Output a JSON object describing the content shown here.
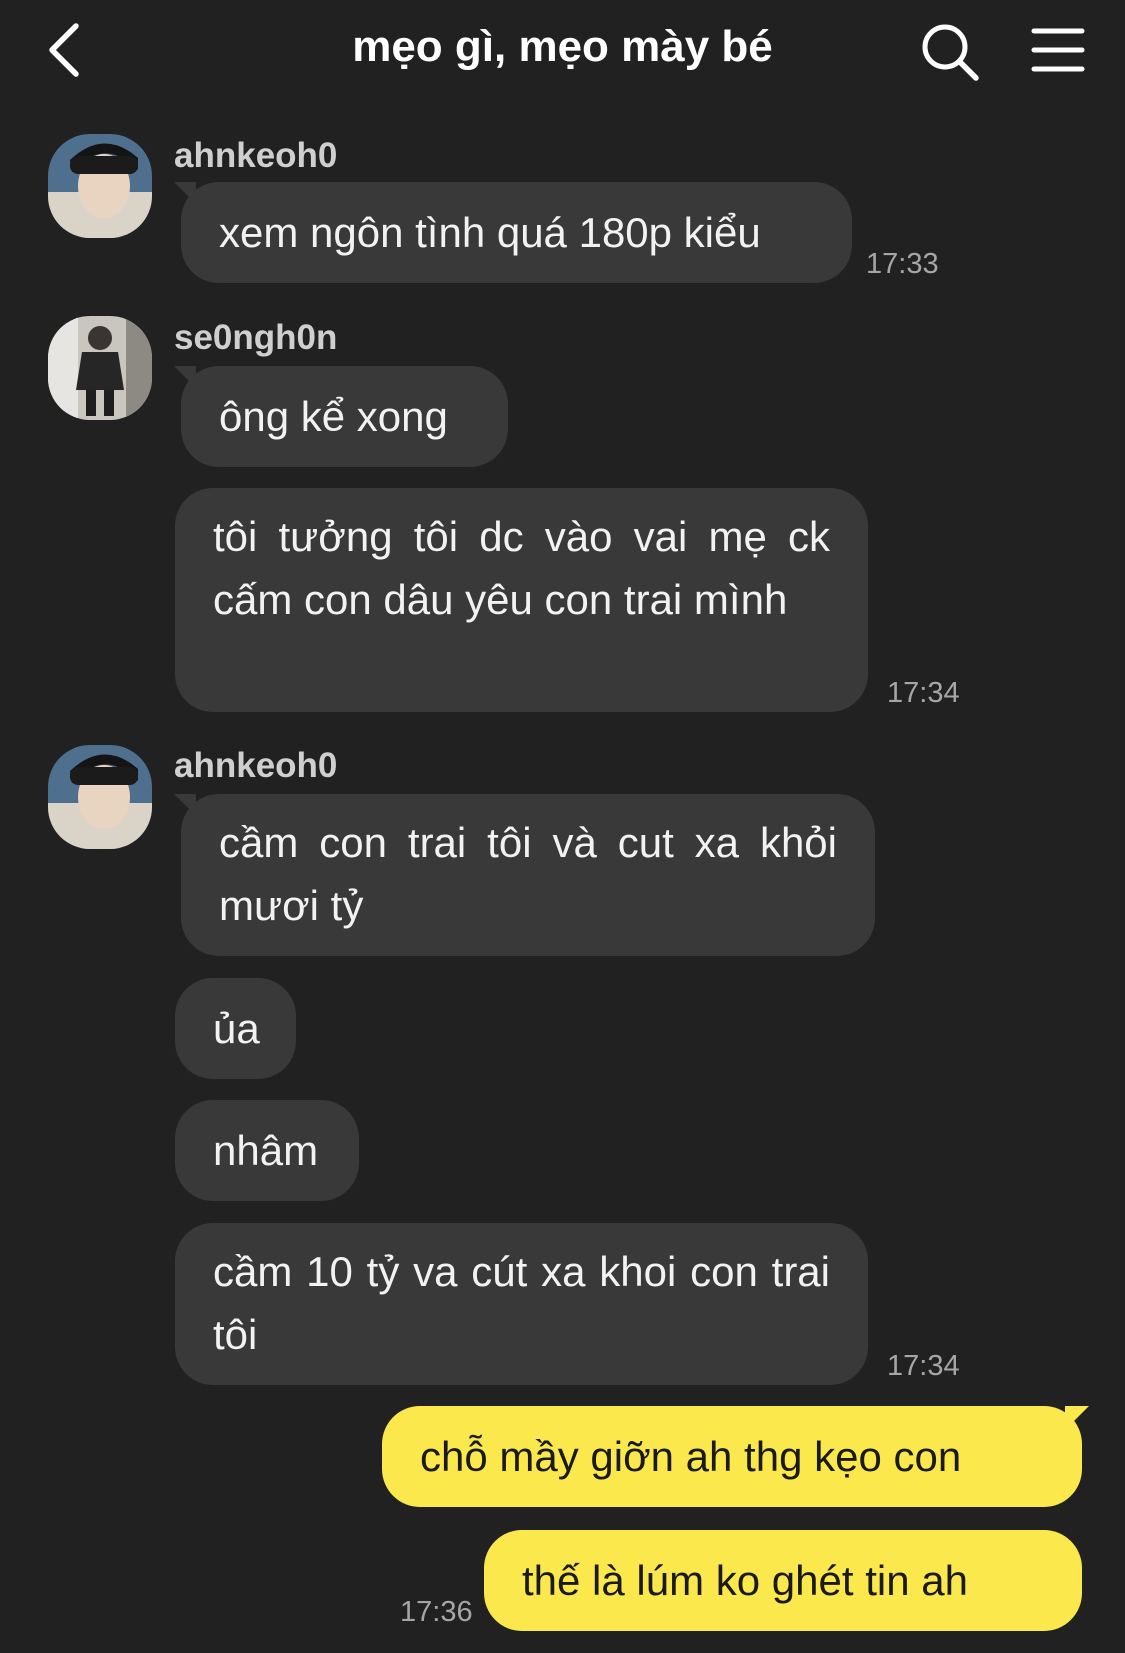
{
  "header": {
    "title": "mẹo gì, mẹo mày bé",
    "back_icon": "chevron-left-icon",
    "search_icon": "search-icon",
    "menu_icon": "hamburger-menu-icon"
  },
  "colors": {
    "background": "#212121",
    "bubble_other": "#393939",
    "bubble_mine": "#fbe84c"
  },
  "messages": [
    {
      "sender": "ahnkeoh0",
      "text": "xem ngôn tình quá 180p kiểu",
      "time": "17:33"
    },
    {
      "sender": "se0ngh0n",
      "text": "ông kể xong"
    },
    {
      "text": "tôi tưởng tôi dc vào vai mẹ ck cấm con dâu yêu con trai mình",
      "time": "17:34"
    },
    {
      "sender": "ahnkeoh0",
      "text": "cầm con trai tôi và cut xa khỏi mươi tỷ"
    },
    {
      "text": "ủa"
    },
    {
      "text": "nhâm"
    },
    {
      "text": "cầm 10 tỷ va cút xa khoi con trai tôi",
      "time": "17:34"
    },
    {
      "text": "chỗ mầy giỡn ah thg kẹo con",
      "mine": true
    },
    {
      "text": "thế là lúm ko ghét tin ah",
      "mine": true,
      "time": "17:36"
    }
  ]
}
